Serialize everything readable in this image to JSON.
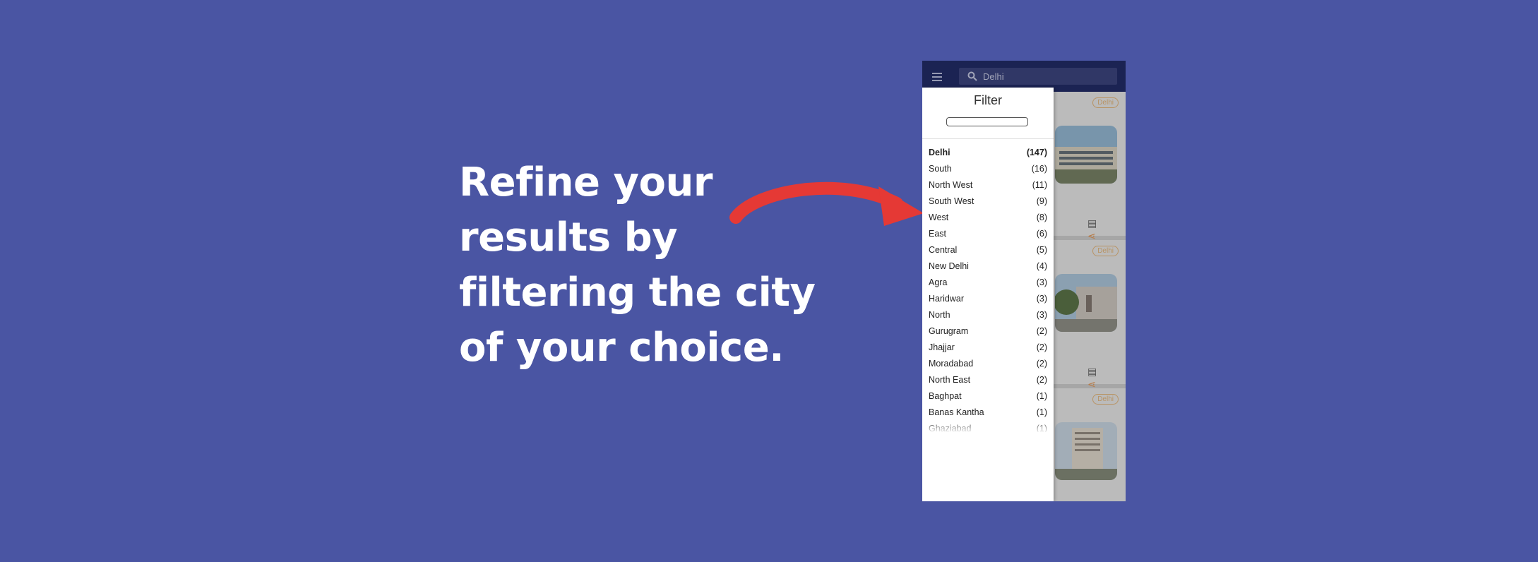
{
  "headline": {
    "lines": [
      "Refine your",
      "results by",
      "filtering the city",
      "of your choice."
    ]
  },
  "app": {
    "search": {
      "value": "Delhi"
    },
    "filter": {
      "title": "Filter",
      "cities": [
        {
          "name": "Delhi",
          "count": "(147)"
        },
        {
          "name": "South",
          "count": "(16)"
        },
        {
          "name": "North West",
          "count": "(11)"
        },
        {
          "name": "South West",
          "count": "(9)"
        },
        {
          "name": "West",
          "count": "(8)"
        },
        {
          "name": "East",
          "count": "(6)"
        },
        {
          "name": "Central",
          "count": "(5)"
        },
        {
          "name": "New Delhi",
          "count": "(4)"
        },
        {
          "name": "Agra",
          "count": "(3)"
        },
        {
          "name": "Haridwar",
          "count": "(3)"
        },
        {
          "name": "North",
          "count": "(3)"
        },
        {
          "name": "Gurugram",
          "count": "(2)"
        },
        {
          "name": "Jhajjar",
          "count": "(2)"
        },
        {
          "name": "Moradabad",
          "count": "(2)"
        },
        {
          "name": "North East",
          "count": "(2)"
        },
        {
          "name": "Baghpat",
          "count": "(1)"
        },
        {
          "name": "Banas Kantha",
          "count": "(1)"
        },
        {
          "name": "Ghaziabad",
          "count": "(1)"
        }
      ]
    },
    "cards": [
      {
        "badge": "Delhi"
      },
      {
        "badge": "Delhi"
      },
      {
        "badge": "Delhi"
      }
    ]
  },
  "colors": {
    "background": "#4a55a3",
    "topbar": "#0f1a5c",
    "arrow": "#e53935",
    "badge": "#e8b572"
  }
}
